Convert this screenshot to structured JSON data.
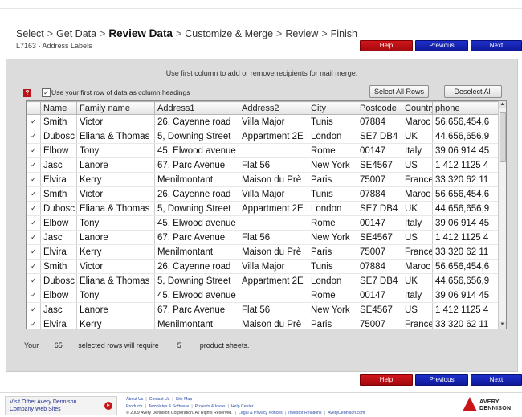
{
  "wizard": {
    "steps": [
      "Select",
      "Get Data",
      "Review Data",
      "Customize & Merge",
      "Review",
      "Finish"
    ],
    "subtitle": "L7163 - Address Labels"
  },
  "nav": {
    "help": "Help",
    "previous": "Previous",
    "next": "Next"
  },
  "panel": {
    "instruction": "Use first column to add or remove recipients for mail merge.",
    "use_first_row_label": "Use your first row of data as column headings",
    "use_first_row_checked": true,
    "select_all": "Select All Rows",
    "deselect_all": "Deselect All"
  },
  "grid": {
    "columns": [
      "Name",
      "Family name",
      "Address1",
      "Address2",
      "City",
      "Postcode",
      "Country",
      "phone"
    ],
    "check_mark": "✓",
    "rows": [
      [
        "Smith",
        "Victor",
        "26, Cayenne road",
        "Villa Major",
        "Tunis",
        "07884",
        "Maroc",
        "56,656,454,6"
      ],
      [
        "Dubosc",
        "Eliana & Thomas",
        "5, Downing Street",
        "Appartment 2E",
        "London",
        "SE7 DB4",
        "UK",
        "44,656,656,9"
      ],
      [
        "Elbow",
        "Tony",
        "45, Elwood avenue",
        "",
        "Rome",
        "00147",
        "Italy",
        "39 06 914 45"
      ],
      [
        "Jasc",
        "Lanore",
        "67, Parc Avenue",
        "Flat 56",
        "New York",
        "SE4567",
        "US",
        "1 412 1125 4"
      ],
      [
        "Elvira",
        "Kerry",
        "Menilmontant",
        "Maison du Prè",
        "Paris",
        "75007",
        "France",
        "33 320 62 11"
      ],
      [
        "Smith",
        "Victor",
        "26, Cayenne road",
        "Villa Major",
        "Tunis",
        "07884",
        "Maroc",
        "56,656,454,6"
      ],
      [
        "Dubosc",
        "Eliana & Thomas",
        "5, Downing Street",
        "Appartment 2E",
        "London",
        "SE7 DB4",
        "UK",
        "44,656,656,9"
      ],
      [
        "Elbow",
        "Tony",
        "45, Elwood avenue",
        "",
        "Rome",
        "00147",
        "Italy",
        "39 06 914 45"
      ],
      [
        "Jasc",
        "Lanore",
        "67, Parc Avenue",
        "Flat 56",
        "New York",
        "SE4567",
        "US",
        "1 412 1125 4"
      ],
      [
        "Elvira",
        "Kerry",
        "Menilmontant",
        "Maison du Prè",
        "Paris",
        "75007",
        "France",
        "33 320 62 11"
      ],
      [
        "Smith",
        "Victor",
        "26, Cayenne road",
        "Villa Major",
        "Tunis",
        "07884",
        "Maroc",
        "56,656,454,6"
      ],
      [
        "Dubosc",
        "Eliana & Thomas",
        "5, Downing Street",
        "Appartment 2E",
        "London",
        "SE7 DB4",
        "UK",
        "44,656,656,9"
      ],
      [
        "Elbow",
        "Tony",
        "45, Elwood avenue",
        "",
        "Rome",
        "00147",
        "Italy",
        "39 06 914 45"
      ],
      [
        "Jasc",
        "Lanore",
        "67, Parc Avenue",
        "Flat 56",
        "New York",
        "SE4567",
        "US",
        "1 412 1125 4"
      ],
      [
        "Elvira",
        "Kerry",
        "Menilmontant",
        "Maison du Prè",
        "Paris",
        "75007",
        "France",
        "33 320 62 11"
      ]
    ]
  },
  "summary": {
    "prefix": "Your",
    "rows": "65",
    "middle": "selected rows will require",
    "sheets": "5",
    "suffix": "product sheets."
  },
  "footer": {
    "visit_line1": "Visit Other Avery Dennison",
    "visit_line2": "Company Web Sites",
    "links_row1": [
      "About Us",
      "Contact Us",
      "Site Map"
    ],
    "links_row2": [
      "Products",
      "Templates & Software",
      "Projects & Ideas",
      "Help Center"
    ],
    "copyright": "© 2009 Avery Dennison Corporation. All Rights Reserved.",
    "links_row3": [
      "Legal & Privacy Notices",
      "Investor Relations",
      "AveryDennison.com"
    ],
    "logo_line1": "AVERY",
    "logo_line2": "DENNISON"
  },
  "colors": {
    "help_red": "#c8141b",
    "nav_blue": "#1a2bbd",
    "panel_gray": "#dcdcdc"
  }
}
